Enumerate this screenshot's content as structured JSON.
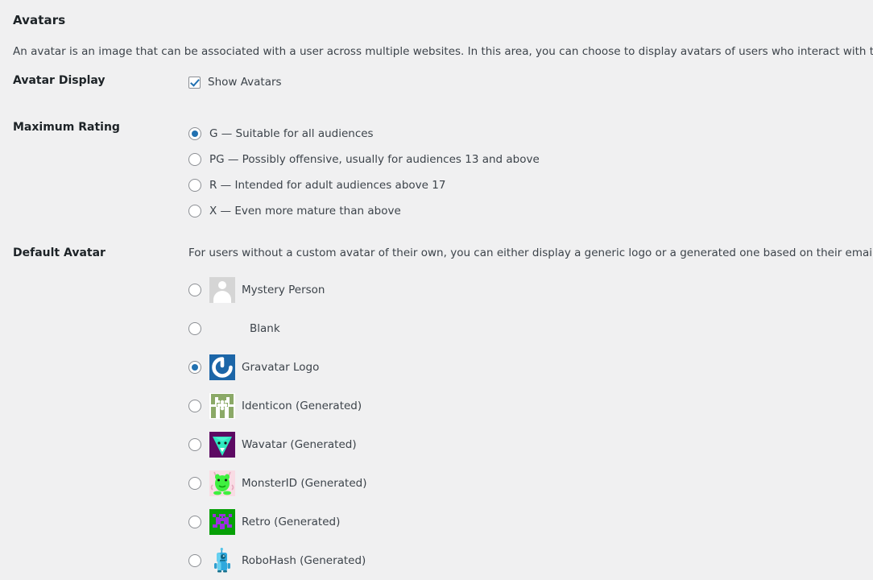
{
  "page": {
    "heading": "Avatars",
    "intro": "An avatar is an image that can be associated with a user across multiple websites. In this area, you can choose to display avatars of users who interact with the site.",
    "background_color": "#f0f0f1",
    "accent_color": "#2271b1"
  },
  "avatar_display": {
    "label": "Avatar Display",
    "checkbox_label": "Show Avatars",
    "checked": true
  },
  "maximum_rating": {
    "label": "Maximum Rating",
    "options": [
      {
        "label": "G — Suitable for all audiences",
        "checked": true
      },
      {
        "label": "PG — Possibly offensive, usually for audiences 13 and above",
        "checked": false
      },
      {
        "label": "R — Intended for adult audiences above 17",
        "checked": false
      },
      {
        "label": "X — Even more mature than above",
        "checked": false
      }
    ]
  },
  "default_avatar": {
    "label": "Default Avatar",
    "description": "For users without a custom avatar of their own, you can either display a generic logo or a generated one based on their email address.",
    "options": [
      {
        "label": "Mystery Person",
        "checked": false,
        "icon": "mystery-person-avatar-icon"
      },
      {
        "label": "Blank",
        "checked": false,
        "icon": "blank-avatar-icon"
      },
      {
        "label": "Gravatar Logo",
        "checked": true,
        "icon": "gravatar-logo-icon"
      },
      {
        "label": "Identicon (Generated)",
        "checked": false,
        "icon": "identicon-avatar-icon"
      },
      {
        "label": "Wavatar (Generated)",
        "checked": false,
        "icon": "wavatar-avatar-icon"
      },
      {
        "label": "MonsterID (Generated)",
        "checked": false,
        "icon": "monsterid-avatar-icon"
      },
      {
        "label": "Retro (Generated)",
        "checked": false,
        "icon": "retro-avatar-icon"
      },
      {
        "label": "RoboHash (Generated)",
        "checked": false,
        "icon": "robohash-avatar-icon"
      }
    ]
  }
}
